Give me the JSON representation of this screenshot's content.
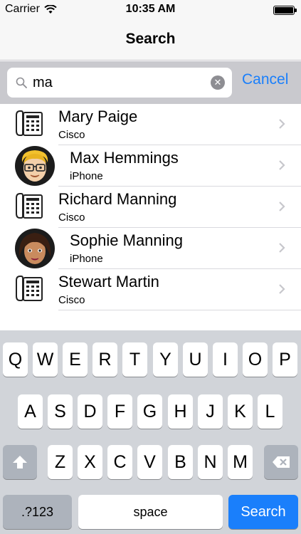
{
  "status_bar": {
    "carrier": "Carrier",
    "time": "10:35 AM",
    "icons": [
      "wifi-icon",
      "battery-icon"
    ]
  },
  "nav": {
    "title": "Search"
  },
  "search": {
    "value": "ma",
    "cancel_label": "Cancel",
    "icons": [
      "search-icon",
      "clear-icon"
    ]
  },
  "results": [
    {
      "name": "Mary Paige",
      "sub": "Cisco",
      "icon": "phone-icon"
    },
    {
      "name": "Max Hemmings",
      "sub": "iPhone",
      "icon": "avatar-male"
    },
    {
      "name": "Richard Manning",
      "sub": "Cisco",
      "icon": "phone-icon"
    },
    {
      "name": "Sophie Manning",
      "sub": "iPhone",
      "icon": "avatar-female"
    },
    {
      "name": "Stewart Martin",
      "sub": "Cisco",
      "icon": "phone-icon"
    }
  ],
  "keyboard": {
    "row1": [
      "Q",
      "W",
      "E",
      "R",
      "T",
      "Y",
      "U",
      "I",
      "O",
      "P"
    ],
    "row2": [
      "A",
      "S",
      "D",
      "F",
      "G",
      "H",
      "J",
      "K",
      "L"
    ],
    "row3": [
      "Z",
      "X",
      "C",
      "V",
      "B",
      "N",
      "M"
    ],
    "numbers_label": ".?123",
    "space_label": "space",
    "search_label": "Search",
    "icons": [
      "shift-icon",
      "backspace-icon"
    ]
  },
  "colors": {
    "accent": "#1a7ffb",
    "keyboard_bg": "#d1d4d9",
    "search_bar_bg": "#c9c9ce"
  }
}
